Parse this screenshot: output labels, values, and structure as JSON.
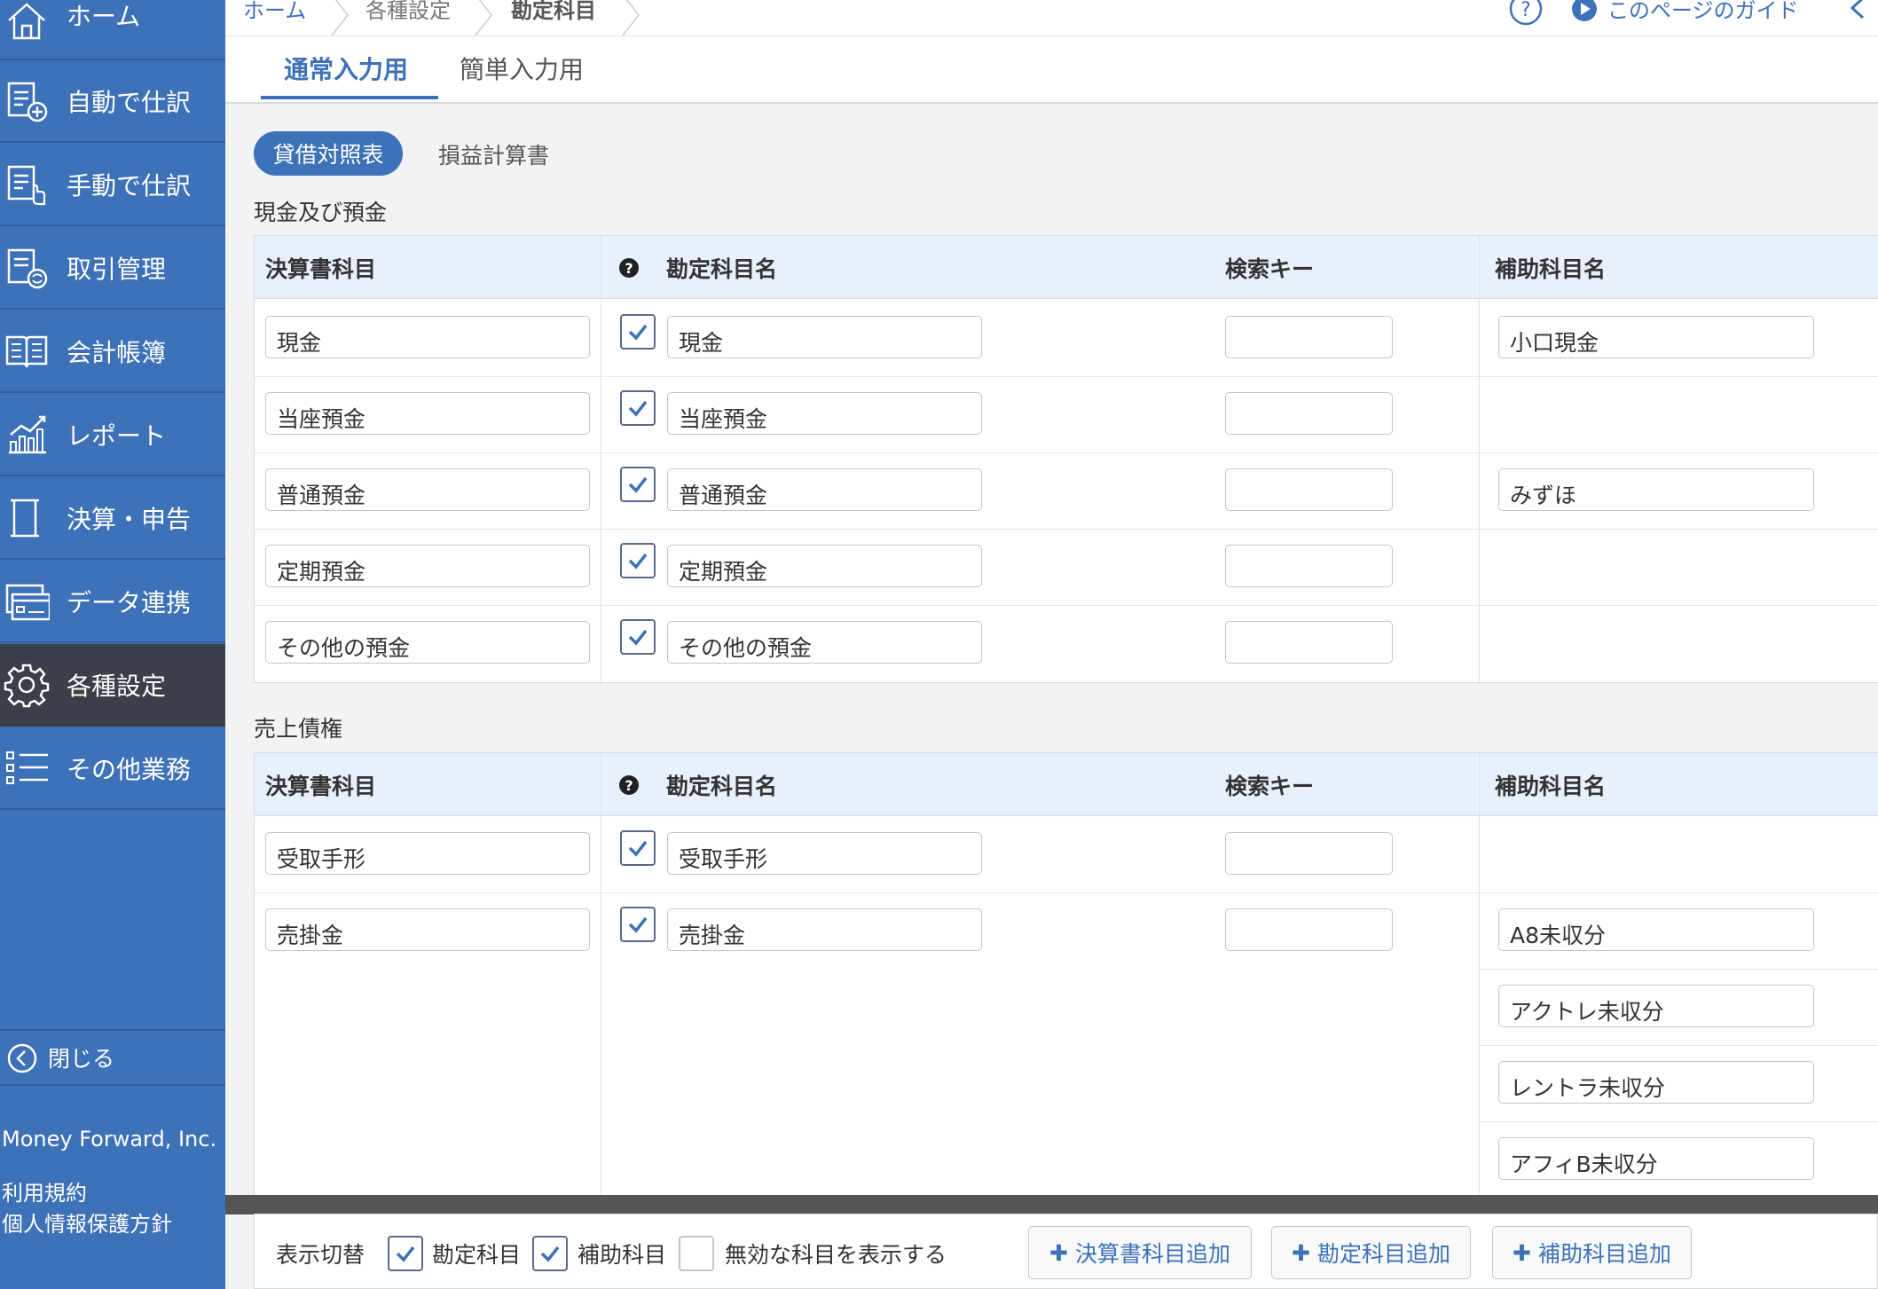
{
  "sidebar": {
    "items": [
      {
        "label": "ホーム",
        "icon": "home-icon"
      },
      {
        "label": "自動で仕訳",
        "icon": "auto-journal-icon"
      },
      {
        "label": "手動で仕訳",
        "icon": "manual-journal-icon"
      },
      {
        "label": "取引管理",
        "icon": "transaction-icon"
      },
      {
        "label": "会計帳簿",
        "icon": "ledger-book-icon"
      },
      {
        "label": "レポート",
        "icon": "report-chart-icon"
      },
      {
        "label": "決算・申告",
        "icon": "settlement-icon"
      },
      {
        "label": "データ連携",
        "icon": "data-link-icon"
      },
      {
        "label": "各種設定",
        "icon": "gear-icon",
        "active": true
      },
      {
        "label": "その他業務",
        "icon": "list-icon"
      }
    ],
    "close_label": "閉じる",
    "company": "Money Forward, Inc.",
    "terms": "利用規約",
    "privacy": "個人情報保護方針"
  },
  "breadcrumb": {
    "home": "ホーム",
    "settings": "各種設定",
    "current": "勘定科目"
  },
  "guide_label": "このページのガイド",
  "tabs": {
    "normal": "通常入力用",
    "simple": "簡単入力用"
  },
  "subtabs": {
    "balance": "貸借対照表",
    "pl": "損益計算書"
  },
  "columns": {
    "statement": "決算書科目",
    "account": "勘定科目名",
    "search_key": "検索キー",
    "sub_account": "補助科目名"
  },
  "sections": [
    {
      "title": "現金及び預金",
      "rows": [
        {
          "statement": "現金",
          "account": "現金",
          "search_key": "",
          "sub": [
            "小口現金"
          ]
        },
        {
          "statement": "当座預金",
          "account": "当座預金",
          "search_key": "",
          "sub": []
        },
        {
          "statement": "普通預金",
          "account": "普通預金",
          "search_key": "",
          "sub": [
            "みずほ"
          ]
        },
        {
          "statement": "定期預金",
          "account": "定期預金",
          "search_key": "",
          "sub": []
        },
        {
          "statement": "その他の預金",
          "account": "その他の預金",
          "search_key": "",
          "sub": []
        }
      ]
    },
    {
      "title": "売上債権",
      "rows": [
        {
          "statement": "受取手形",
          "account": "受取手形",
          "search_key": "",
          "sub": []
        },
        {
          "statement": "売掛金",
          "account": "売掛金",
          "search_key": "",
          "sub": [
            "A8未収分",
            "アクトレ未収分",
            "レントラ未収分",
            "アフィB未収分"
          ]
        }
      ]
    }
  ],
  "toolbar": {
    "toggle_label": "表示切替",
    "cb_account": "勘定科目",
    "cb_sub": "補助科目",
    "cb_inactive": "無効な科目を表示する",
    "btn_statement": "決算書科目追加",
    "btn_account": "勘定科目追加",
    "btn_sub": "補助科目追加"
  },
  "colors": {
    "sidebar": "#3d71b8",
    "active": "#3a3f4a",
    "header": "#e7f0fb",
    "accent": "#3d71b8"
  }
}
